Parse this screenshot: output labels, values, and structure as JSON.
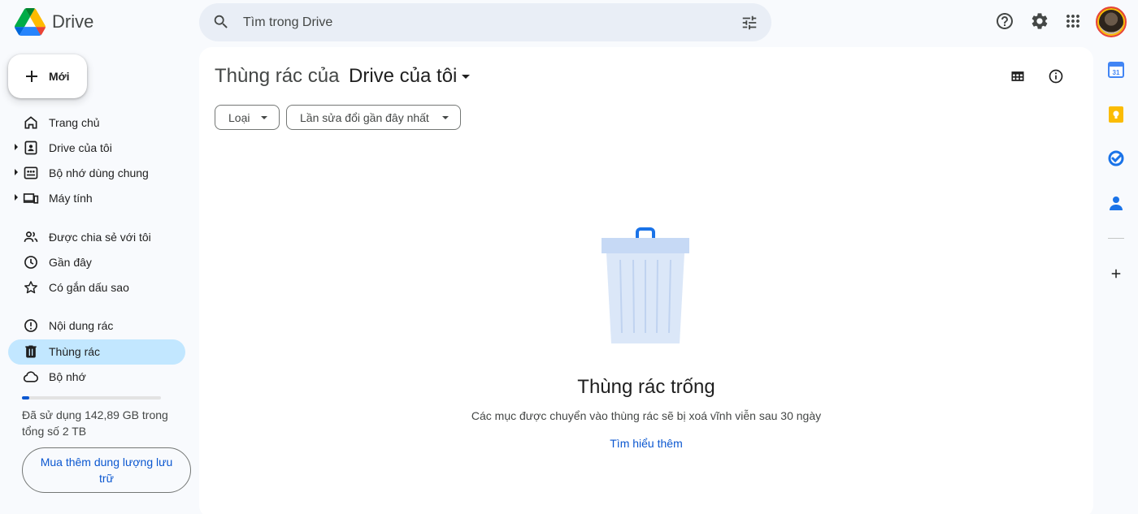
{
  "header": {
    "app_name": "Drive",
    "search_placeholder": "Tìm trong Drive"
  },
  "sidebar": {
    "new_label": "Mới",
    "items": [
      {
        "label": "Trang chủ",
        "icon": "home-icon"
      },
      {
        "label": "Drive của tôi",
        "icon": "my-drive-icon"
      },
      {
        "label": "Bộ nhớ dùng chung",
        "icon": "shared-drives-icon"
      },
      {
        "label": "Máy tính",
        "icon": "computers-icon"
      },
      {
        "label": "Được chia sẻ với tôi",
        "icon": "shared-with-me-icon"
      },
      {
        "label": "Gần đây",
        "icon": "recent-icon"
      },
      {
        "label": "Có gắn dấu sao",
        "icon": "star-icon"
      },
      {
        "label": "Nội dung rác",
        "icon": "spam-icon"
      },
      {
        "label": "Thùng rác",
        "icon": "trash-icon"
      },
      {
        "label": "Bộ nhớ",
        "icon": "cloud-icon"
      }
    ],
    "active_item": "Thùng rác",
    "storage": {
      "used_fraction": 0.05,
      "text": "Đã sử dụng 142,89 GB trong tổng số 2 TB",
      "buy_label": "Mua thêm dung lượng lưu trữ"
    }
  },
  "main": {
    "title_prefix": "Thùng rác của",
    "title_drive": "Drive của tôi",
    "filters": [
      {
        "label": "Loại"
      },
      {
        "label": "Lần sửa đổi gần đây nhất"
      }
    ],
    "empty_title": "Thùng rác trống",
    "empty_subtitle": "Các mục được chuyển vào thùng rác sẽ bị xoá vĩnh viễn sau 30 ngày",
    "learn_more": "Tìm hiểu thêm"
  },
  "right_rail": {
    "calendar_day": "31",
    "apps": [
      "calendar-icon",
      "keep-icon",
      "tasks-icon",
      "contacts-icon",
      "add-icon"
    ]
  },
  "colors": {
    "accent": "#0b57d0",
    "active_bg": "#c2e7ff",
    "search_bg": "#e9eef6",
    "page_bg": "#f8fafd"
  }
}
